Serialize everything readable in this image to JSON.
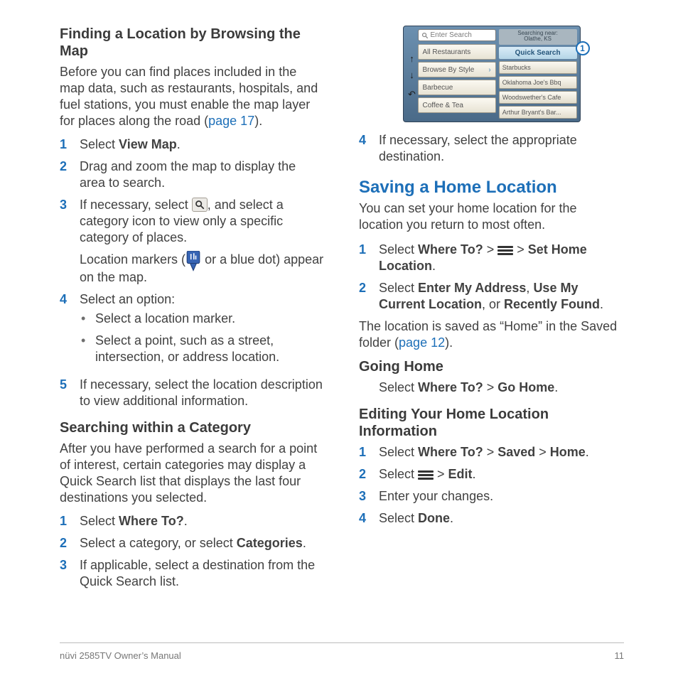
{
  "left": {
    "s1_title": "Finding a Location by Browsing the Map",
    "s1_intro_a": "Before you can find places included in the map data, such as restaurants, hospitals, and fuel stations, you must enable the map layer for places along the road (",
    "s1_intro_link": "page 17",
    "s1_intro_b": ").",
    "s1_steps": {
      "1": {
        "a": "Select ",
        "b": "View Map",
        "c": "."
      },
      "2": "Drag and zoom the map to display the area to search.",
      "3": {
        "a": "If necessary, select ",
        "b": ", and select a category icon to view only a specific category of places."
      },
      "3b": {
        "a": "Location markers (",
        "b": " or a blue dot) appear on the map."
      },
      "4": "Select an option:",
      "4_b1": "Select a location marker.",
      "4_b2": "Select a point, such as a street, intersection, or address location.",
      "5": "If necessary, select the location description to view additional information."
    },
    "s2_title": "Searching within a Category",
    "s2_intro": "After you have performed a search for a point of interest, certain categories may display a Quick Search list that displays the last four destinations you selected.",
    "s2_steps": {
      "1": {
        "a": "Select ",
        "b": "Where To?",
        "c": "."
      },
      "2": {
        "a": "Select a category, or select ",
        "b": "Categories",
        "c": "."
      },
      "3": "If applicable, select a destination from the Quick Search list."
    }
  },
  "right": {
    "device": {
      "search_placeholder": "Enter Search",
      "near_label": "Searching near:",
      "near_value": "Olathe, KS",
      "categories": [
        "All Restaurants",
        "Browse By Style",
        "Barbecue",
        "Coffee & Tea"
      ],
      "qs_title": "Quick Search",
      "qs_items": [
        "Starbucks",
        "Oklahoma Joe's Bbq",
        "Woodswether's Cafe",
        "Arthur Bryant's Bar..."
      ],
      "callout": "1"
    },
    "step4": "If necessary, select the appropriate destination.",
    "h2": "Saving a Home Location",
    "h2_intro": "You can set your home location for the location you return to most often.",
    "h2_steps": {
      "1": {
        "a": "Select ",
        "b": "Where To?",
        "c": " > ",
        "d": " > ",
        "e": "Set Home Location",
        "f": "."
      },
      "2": {
        "a": "Select ",
        "b": "Enter My Address",
        "c": ", ",
        "d": "Use My Current Location",
        "e": ", or ",
        "f": "Recently Found",
        "g": "."
      }
    },
    "h2_after_a": "The location is saved as “Home” in the Saved folder (",
    "h2_after_link": "page 12",
    "h2_after_b": ").",
    "s3_title": "Going Home",
    "s3_line": {
      "a": "Select ",
      "b": "Where To?",
      "c": " > ",
      "d": "Go Home",
      "e": "."
    },
    "s4_title": "Editing Your Home Location Information",
    "s4_steps": {
      "1": {
        "a": "Select ",
        "b": "Where To?",
        "c": " > ",
        "d": "Saved",
        "e": " > ",
        "f": "Home",
        "g": "."
      },
      "2": {
        "a": "Select ",
        "b": " > ",
        "c": "Edit",
        "d": "."
      },
      "3": "Enter your changes.",
      "4": {
        "a": "Select ",
        "b": "Done",
        "c": "."
      }
    }
  },
  "footer": {
    "left": "nüvi 2585TV Owner’s Manual",
    "right": "11"
  }
}
